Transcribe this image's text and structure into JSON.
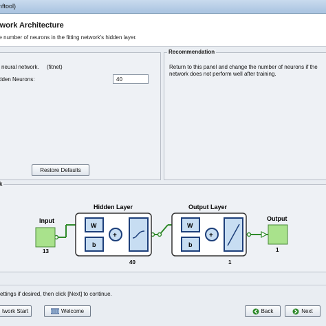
{
  "window": {
    "title": "nftool)"
  },
  "header": {
    "title": "twork Architecture",
    "subtitle": "he number of neurons in the fitting network's hidden layer."
  },
  "left_panel": {
    "network_type_label": "neural network.",
    "network_type_value": "(fitnet)",
    "hidden_neurons_label": "dden Neurons:",
    "hidden_neurons_value": "40",
    "restore_button": "Restore Defaults"
  },
  "recommendation": {
    "title": "Recommendation",
    "text": "Return to this panel and change the number of neurons if the network does not perform well after training."
  },
  "network": {
    "title": "k",
    "input_label": "Input",
    "input_size": "13",
    "hidden_title": "Hidden Layer",
    "hidden_size": "40",
    "output_title": "Output Layer",
    "output_size": "1",
    "output_label": "Output",
    "output_count": "1",
    "w_label": "W",
    "b_label": "b",
    "plus_label": "+"
  },
  "footer": {
    "instruction": "settings if desired, then click [Next] to continue.",
    "start_button": "twork Start",
    "welcome_button": "Welcome",
    "back_button": "Back",
    "next_button": "Next"
  },
  "colors": {
    "block_fill": "#c7ddf2",
    "block_border": "#1d3f7a",
    "io_fill": "#a9e28c",
    "wire": "#2f8a2a"
  }
}
